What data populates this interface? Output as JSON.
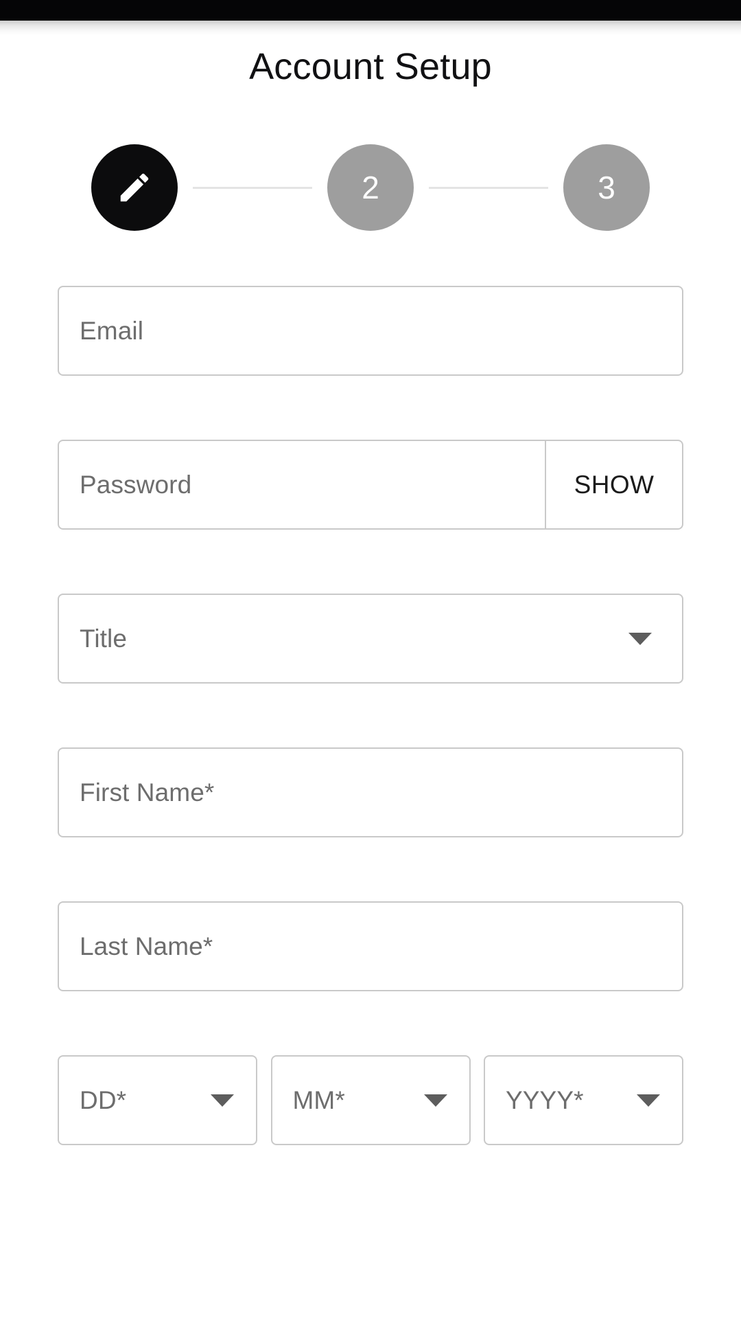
{
  "window": {
    "status_bar_color": "#050506",
    "background_color": "#ffffff"
  },
  "header": {
    "title": "Account Setup"
  },
  "stepper": {
    "active_color": "#0c0c0d",
    "inactive_color": "#9e9e9e",
    "line_color": "#e4e4e4",
    "steps": [
      {
        "label": "",
        "icon": "pencil-icon",
        "state": "active"
      },
      {
        "label": "2",
        "icon": "",
        "state": "inactive"
      },
      {
        "label": "3",
        "icon": "",
        "state": "inactive"
      }
    ]
  },
  "form": {
    "border_color": "#c9c9c9",
    "placeholder_color": "#6d6d6d",
    "email": {
      "placeholder": "Email",
      "value": ""
    },
    "password": {
      "placeholder": "Password",
      "value": "",
      "show_label": "SHOW"
    },
    "title_select": {
      "placeholder": "Title",
      "value": "",
      "caret_icon": "chevron-down-icon"
    },
    "first_name": {
      "placeholder": "First Name*",
      "value": ""
    },
    "last_name": {
      "placeholder": "Last Name*",
      "value": ""
    },
    "date_of_birth": {
      "day": {
        "placeholder": "DD*",
        "value": "",
        "caret_icon": "chevron-down-icon"
      },
      "month": {
        "placeholder": "MM*",
        "value": "",
        "caret_icon": "chevron-down-icon"
      },
      "year": {
        "placeholder": "YYYY*",
        "value": "",
        "caret_icon": "chevron-down-icon"
      }
    }
  }
}
